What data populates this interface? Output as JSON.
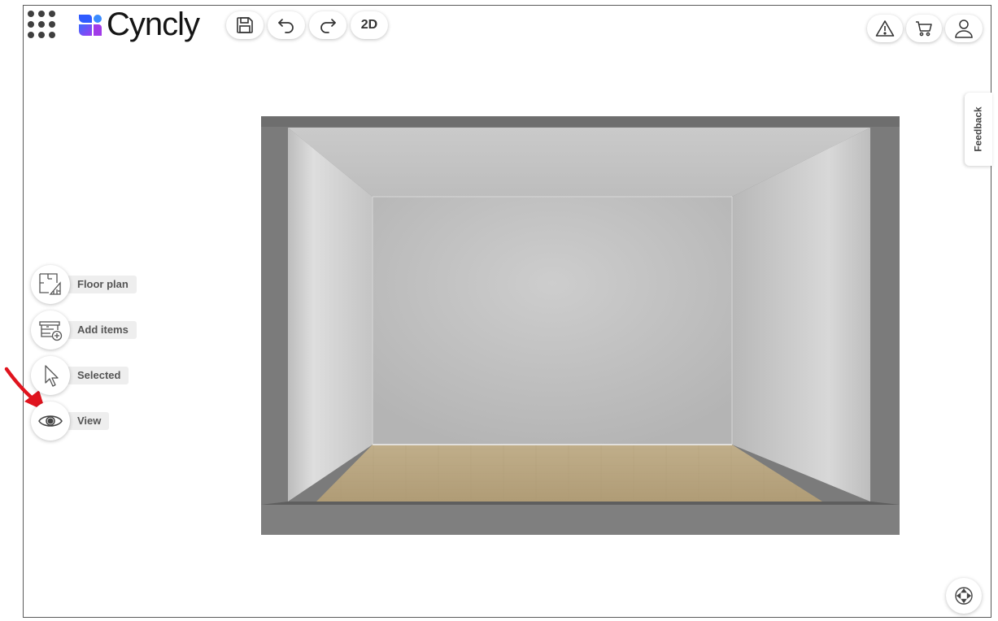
{
  "header": {
    "logo_text": "Cyncly",
    "toolbar": {
      "save_icon": "save-icon",
      "undo_icon": "undo-icon",
      "redo_icon": "redo-icon",
      "view_mode_label": "2D"
    },
    "right": {
      "warning_icon": "warning-icon",
      "cart_icon": "cart-icon",
      "user_icon": "user-icon"
    }
  },
  "feedback": {
    "label": "Feedback"
  },
  "tools": [
    {
      "label": "Floor plan",
      "icon": "floor-plan-icon"
    },
    {
      "label": "Add items",
      "icon": "add-items-icon"
    },
    {
      "label": "Selected",
      "icon": "cursor-icon"
    },
    {
      "label": "View",
      "icon": "eye-icon"
    }
  ],
  "colors": {
    "logo_blue": "#3b6bff",
    "logo_purple": "#9b3cf0",
    "annotation_red": "#e0141e",
    "floor": "#b8a47e",
    "wall_light": "#d0d0d0",
    "frame_gray": "#787878"
  }
}
